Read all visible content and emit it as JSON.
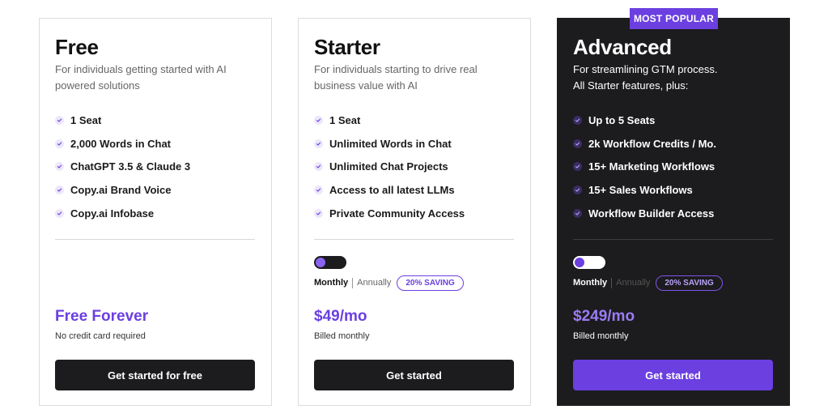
{
  "colors": {
    "accent": "#6b3fe0",
    "dark_card": "#1c1b1d",
    "button_dark": "#1c1b1d"
  },
  "plans": [
    {
      "name": "Free",
      "description": "For individuals getting started with AI powered solutions",
      "features": [
        "1 Seat",
        "2,000 Words in Chat",
        "ChatGPT 3.5 & Claude 3",
        "Copy.ai Brand Voice",
        "Copy.ai Infobase"
      ],
      "price": "Free Forever",
      "price_note": "No credit card required",
      "cta": "Get started for free"
    },
    {
      "name": "Starter",
      "description": "For individuals starting to drive real business value with AI",
      "features": [
        "1 Seat",
        "Unlimited Words in Chat",
        "Unlimited Chat Projects",
        "Access to all latest LLMs",
        "Private Community Access"
      ],
      "billing": {
        "monthly": "Monthly",
        "annually": "Annually",
        "saving": "20% SAVING"
      },
      "price": "$49/mo",
      "price_note": "Billed monthly",
      "cta": "Get started"
    },
    {
      "badge": "MOST POPULAR",
      "name": "Advanced",
      "description_lines": [
        "For streamlining GTM process.",
        "All Starter features, plus:"
      ],
      "features": [
        "Up to 5 Seats",
        "2k Workflow Credits / Mo.",
        "15+ Marketing Workflows",
        "15+ Sales Workflows",
        "Workflow Builder Access"
      ],
      "billing": {
        "monthly": "Monthly",
        "annually": "Annually",
        "saving": "20% SAVING"
      },
      "price": "$249/mo",
      "price_note": "Billed monthly",
      "cta": "Get started"
    }
  ]
}
